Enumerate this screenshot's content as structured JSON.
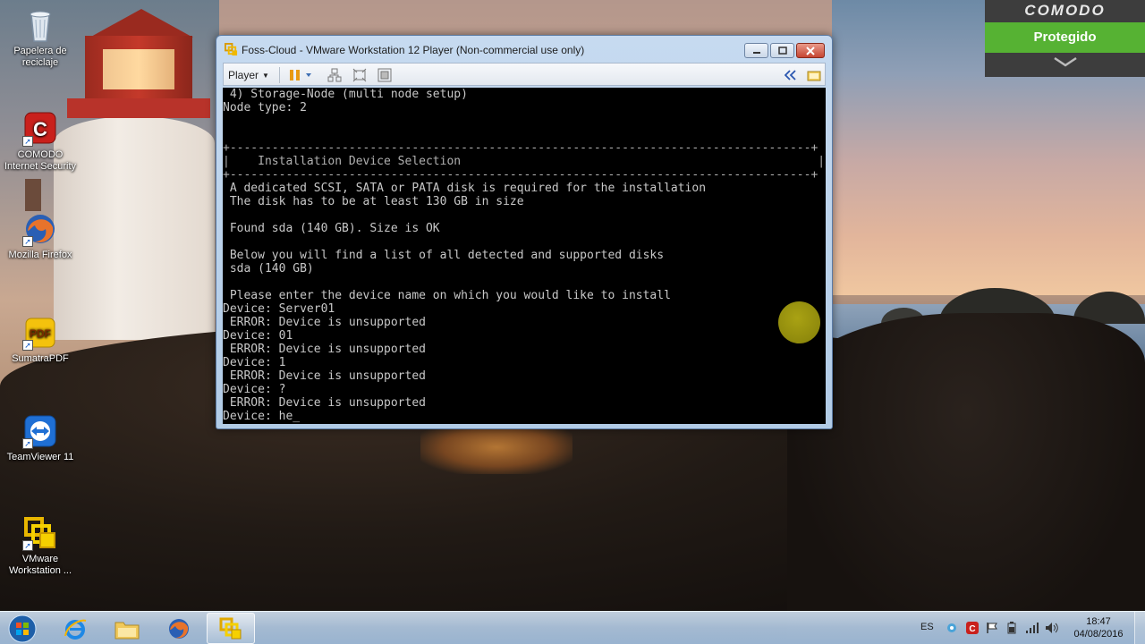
{
  "desktop": {
    "icons": [
      {
        "label": "Papelera de reciclaje",
        "icon": "recycle-bin-icon"
      },
      {
        "label": "COMODO Internet Security",
        "icon": "comodo-icon"
      },
      {
        "label": "Mozilla Firefox",
        "icon": "firefox-icon"
      },
      {
        "label": "SumatraPDF",
        "icon": "pdf-icon"
      },
      {
        "label": "TeamViewer 11",
        "icon": "teamviewer-icon"
      },
      {
        "label": "VMware Workstation ...",
        "icon": "vmware-icon"
      }
    ]
  },
  "comodo_widget": {
    "brand": "COMODO",
    "status": "Protegido",
    "colors": {
      "status_bg": "#56b233",
      "panel_bg": "#3d3d3d"
    }
  },
  "vm_window": {
    "title": "Foss-Cloud - VMware Workstation 12 Player (Non-commercial use only)",
    "toolbar": {
      "player_label": "Player"
    }
  },
  "console": {
    "lines": [
      " 4) Storage-Node (multi node setup)",
      "Node type: 2",
      "",
      "",
      "+-----------------------------------------------------------------------------------+",
      "|    Installation Device Selection                                                   |",
      "+-----------------------------------------------------------------------------------+",
      " A dedicated SCSI, SATA or PATA disk is required for the installation",
      " The disk has to be at least 130 GB in size",
      "",
      " Found sda (140 GB). Size is OK",
      "",
      " Below you will find a list of all detected and supported disks",
      " sda (140 GB)",
      "",
      " Please enter the device name on which you would like to install",
      "Device: Server01",
      " ERROR: Device is unsupported",
      "Device: 01",
      " ERROR: Device is unsupported",
      "Device: 1",
      " ERROR: Device is unsupported",
      "Device: ?",
      " ERROR: Device is unsupported",
      "Device: he_"
    ]
  },
  "taskbar": {
    "items": [
      {
        "name": "internet-explorer",
        "icon": "ie-icon"
      },
      {
        "name": "file-explorer",
        "icon": "folder-icon"
      },
      {
        "name": "firefox",
        "icon": "firefox-icon"
      },
      {
        "name": "vmware",
        "icon": "vmware-icon",
        "active": true
      }
    ],
    "tray": {
      "language": "ES",
      "time": "18:47",
      "date": "04/08/2016"
    }
  }
}
